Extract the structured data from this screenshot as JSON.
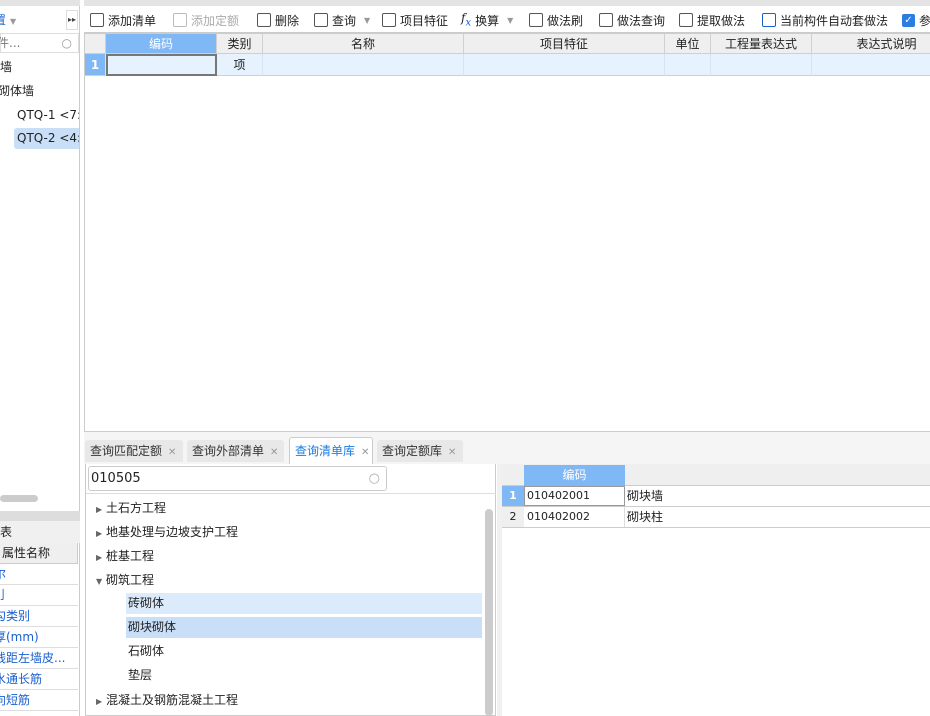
{
  "left_panel": {
    "dropdown_text": "置",
    "search_placeholder": "件...",
    "tree": [
      "墙",
      "砌体墙",
      "QTQ-1 <7:",
      "QTQ-2 <4:"
    ],
    "props_title": "表",
    "props_header": "属性名称",
    "props": [
      "尔",
      "刂",
      "勾类别",
      "厚(mm)",
      "线距左墙皮...",
      "水通长筋",
      "向短筋"
    ]
  },
  "toolbar": {
    "add_list": "添加清单",
    "add_quota": "添加定额",
    "delete": "删除",
    "query": "查询",
    "item_feature": "项目特征",
    "convert": "换算",
    "method_brush": "做法刷",
    "method_query": "做法查询",
    "extract_method": "提取做法",
    "auto_method": "当前构件自动套做法",
    "checkbox_label": "参",
    "checkbox_checked": true
  },
  "main_grid": {
    "columns": [
      "编码",
      "类别",
      "名称",
      "项目特征",
      "单位",
      "工程量表达式",
      "表达式说明"
    ],
    "rows": [
      {
        "num": "1",
        "code": "",
        "type": "项",
        "name": "",
        "feature": "",
        "unit": "",
        "expr": "",
        "desc": ""
      }
    ]
  },
  "bottom_tabs": [
    {
      "label": "查询匹配定额",
      "active": false
    },
    {
      "label": "查询外部清单",
      "active": false
    },
    {
      "label": "查询清单库",
      "active": true
    },
    {
      "label": "查询定额库",
      "active": false
    }
  ],
  "library": {
    "search_value": "010505",
    "tree": [
      {
        "label": "土石方工程",
        "expanded": false
      },
      {
        "label": "地基处理与边坡支护工程",
        "expanded": false
      },
      {
        "label": "桩基工程",
        "expanded": false
      },
      {
        "label": "砌筑工程",
        "expanded": true,
        "children": [
          "砖砌体",
          "砌块砌体",
          "石砌体",
          "垫层"
        ]
      },
      {
        "label": "混凝土及钢筋混凝土工程",
        "expanded": false
      }
    ],
    "selected": "砌块砌体"
  },
  "result_grid": {
    "columns": [
      "编码"
    ],
    "rows": [
      {
        "num": "1",
        "code": "010402001",
        "name": "砌块墙"
      },
      {
        "num": "2",
        "code": "010402002",
        "name": "砌块柱"
      }
    ]
  },
  "colors": {
    "accent": "#7fb8f5",
    "row_bg": "#e6f2fd",
    "selected": "#c9def7",
    "hover": "#dcebfc",
    "link": "#1a5fd0"
  }
}
